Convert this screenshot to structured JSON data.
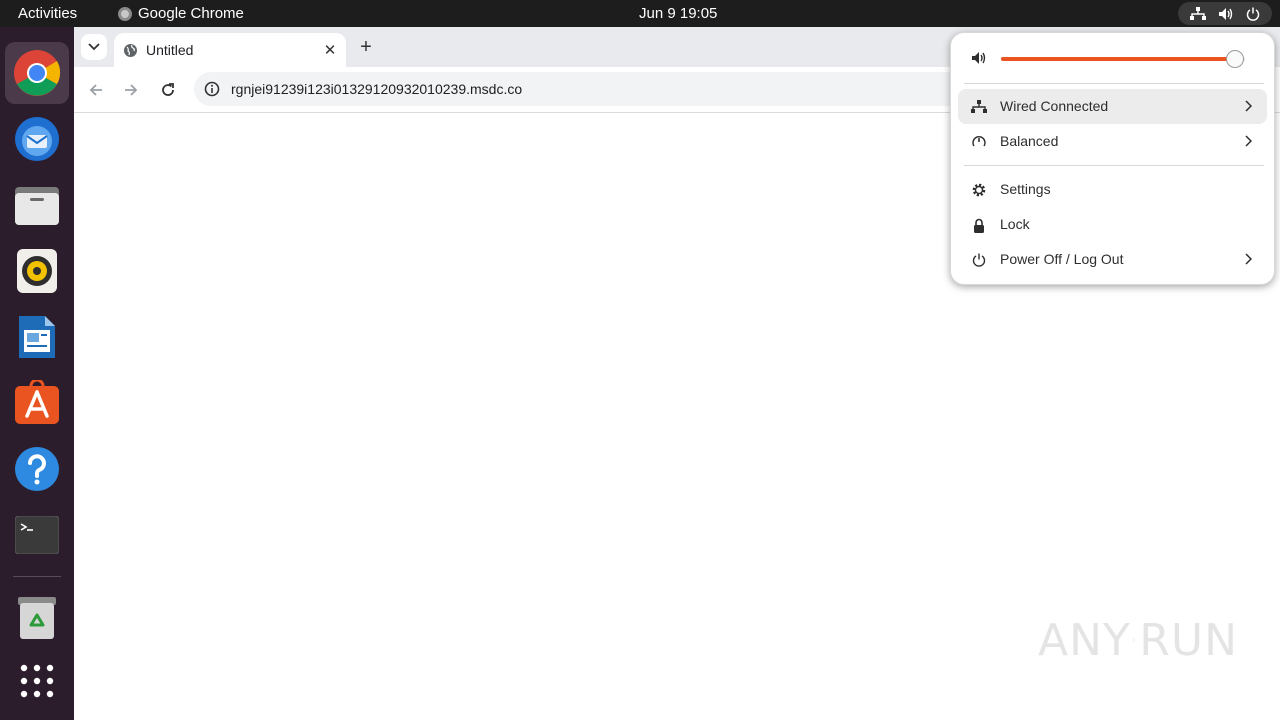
{
  "topbar": {
    "activities_label": "Activities",
    "app_name": "Google Chrome",
    "clock": "Jun 9  19:05",
    "tray_icons": [
      "network-icon",
      "volume-icon",
      "power-icon"
    ]
  },
  "dock": {
    "apps": [
      {
        "name": "Google Chrome",
        "icon": "chrome-icon",
        "active": true
      },
      {
        "name": "Thunderbird Mail",
        "icon": "thunderbird-icon",
        "active": false
      },
      {
        "name": "Files",
        "icon": "files-icon",
        "active": false
      },
      {
        "name": "Rhythmbox",
        "icon": "rhythmbox-icon",
        "active": false
      },
      {
        "name": "LibreOffice Writer",
        "icon": "writer-icon",
        "active": false
      },
      {
        "name": "Ubuntu Software",
        "icon": "software-icon",
        "active": false
      },
      {
        "name": "Help",
        "icon": "help-icon",
        "active": false
      },
      {
        "name": "Terminal",
        "icon": "terminal-icon",
        "active": false
      },
      {
        "name": "Trash",
        "icon": "trash-icon",
        "active": false
      },
      {
        "name": "Show Applications",
        "icon": "app-grid-icon",
        "active": false
      }
    ]
  },
  "browser": {
    "tab": {
      "title": "Untitled",
      "icon": "globe-icon",
      "close_glyph": "✕"
    },
    "new_tab_glyph": "+",
    "address": {
      "url": "rgnjei91239i123i01329120932010239.msdc.co",
      "icon": "info-icon"
    }
  },
  "quick_settings": {
    "volume": {
      "icon": "volume-icon",
      "level": 0.96
    },
    "items": [
      {
        "label": "Wired Connected",
        "icon": "network-icon",
        "has_submenu": true,
        "highlighted": true
      },
      {
        "label": "Balanced",
        "icon": "power-mode-icon",
        "has_submenu": true,
        "highlighted": false
      },
      {
        "label": "Settings",
        "icon": "gear-icon",
        "has_submenu": false,
        "highlighted": false
      },
      {
        "label": "Lock",
        "icon": "lock-icon",
        "has_submenu": false,
        "highlighted": false
      },
      {
        "label": "Power Off / Log Out",
        "icon": "power-icon",
        "has_submenu": true,
        "highlighted": false
      }
    ]
  },
  "watermark": {
    "text_left": "ANY",
    "text_right": "RUN"
  },
  "colors": {
    "accent": "#e95420",
    "topbar_bg": "#1d1d1d",
    "dock_bg": "#2b1d2b",
    "tabstrip_bg": "#e8eaed"
  }
}
